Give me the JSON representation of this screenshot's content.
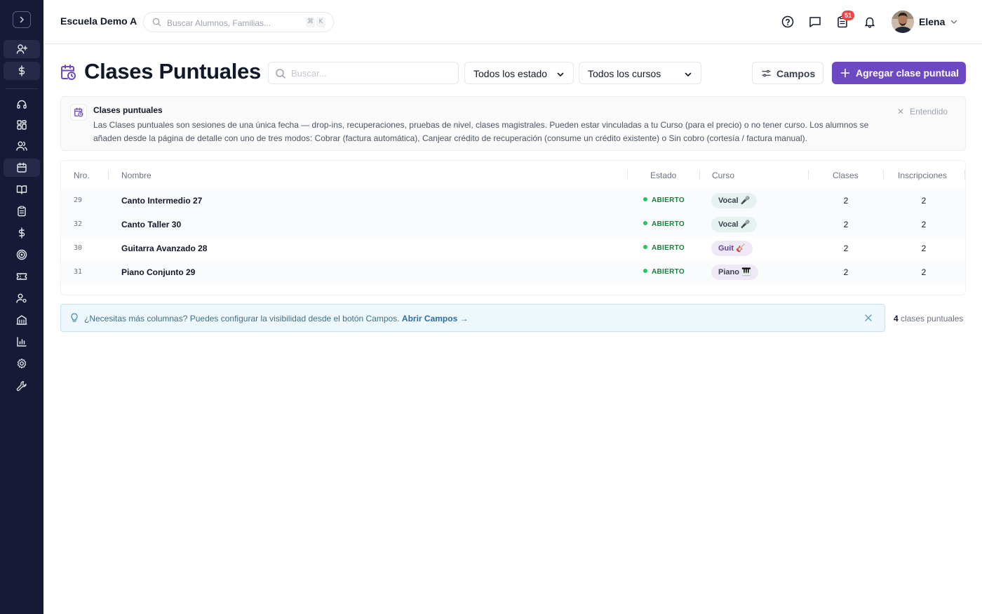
{
  "topbar": {
    "school_name": "Escuela Demo A",
    "search_placeholder": "Buscar Alumnos, Familias...",
    "shortcut_mod": "⌘",
    "shortcut_key": "K",
    "notification_count": "51",
    "user_name": "Elena"
  },
  "sidebar": {
    "items": [
      "expand-toggle",
      "add-person",
      "dollar",
      "headset",
      "dashboard",
      "users",
      "calendar",
      "book",
      "clipboard",
      "billing",
      "target",
      "ticket",
      "user-settings",
      "building",
      "chart",
      "settings",
      "wrench"
    ]
  },
  "page": {
    "title": "Clases Puntuales",
    "search_placeholder": "Buscar...",
    "filter_estado": "Todos los estado",
    "filter_cursos": "Todos los cursos",
    "campos_label": "Campos",
    "add_label": "Agregar clase puntual"
  },
  "info": {
    "title": "Clases puntuales",
    "body": "Las Clases puntuales son sesiones de una única fecha — drop-ins, recuperaciones, pruebas de nivel, clases magistrales. Pueden estar vinculadas a tu Curso (para el precio) o no tener curso. Los alumnos se añaden desde la página de detalle con uno de tres modos: Cobrar (factura automática), Canjear crédito de recuperación (consume un crédito existente) o Sin cobro (cortesía / factura manual).",
    "dismiss": "Entendido"
  },
  "table": {
    "headers": {
      "nro": "Nro.",
      "nombre": "Nombre",
      "estado": "Estado",
      "curso": "Curso",
      "clases": "Clases",
      "inscripciones": "Inscripciones"
    },
    "rows": [
      {
        "nro": "29",
        "nombre": "Canto Intermedio 27",
        "estado": "ABIERTO",
        "curso": "Vocal 🎤",
        "clases": "2",
        "inscripciones": "2"
      },
      {
        "nro": "32",
        "nombre": "Canto Taller 30",
        "estado": "ABIERTO",
        "curso": "Vocal 🎤",
        "clases": "2",
        "inscripciones": "2"
      },
      {
        "nro": "30",
        "nombre": "Guitarra Avanzado 28",
        "estado": "ABIERTO",
        "curso": "Guit 🎸",
        "clases": "2",
        "inscripciones": "2"
      },
      {
        "nro": "31",
        "nombre": "Piano Conjunto 29",
        "estado": "ABIERTO",
        "curso": "Piano 🎹",
        "clases": "2",
        "inscripciones": "2"
      }
    ]
  },
  "hint": {
    "text": "¿Necesitas más columnas? Puedes configurar la visibilidad desde el botón Campos.",
    "link": "Abrir Campos →"
  },
  "footer": {
    "count": "4",
    "count_label": "clases puntuales"
  },
  "colors": {
    "sidebar_bg": "#171a36",
    "accent": "#6e48c2",
    "status_green": "#22c55e"
  }
}
